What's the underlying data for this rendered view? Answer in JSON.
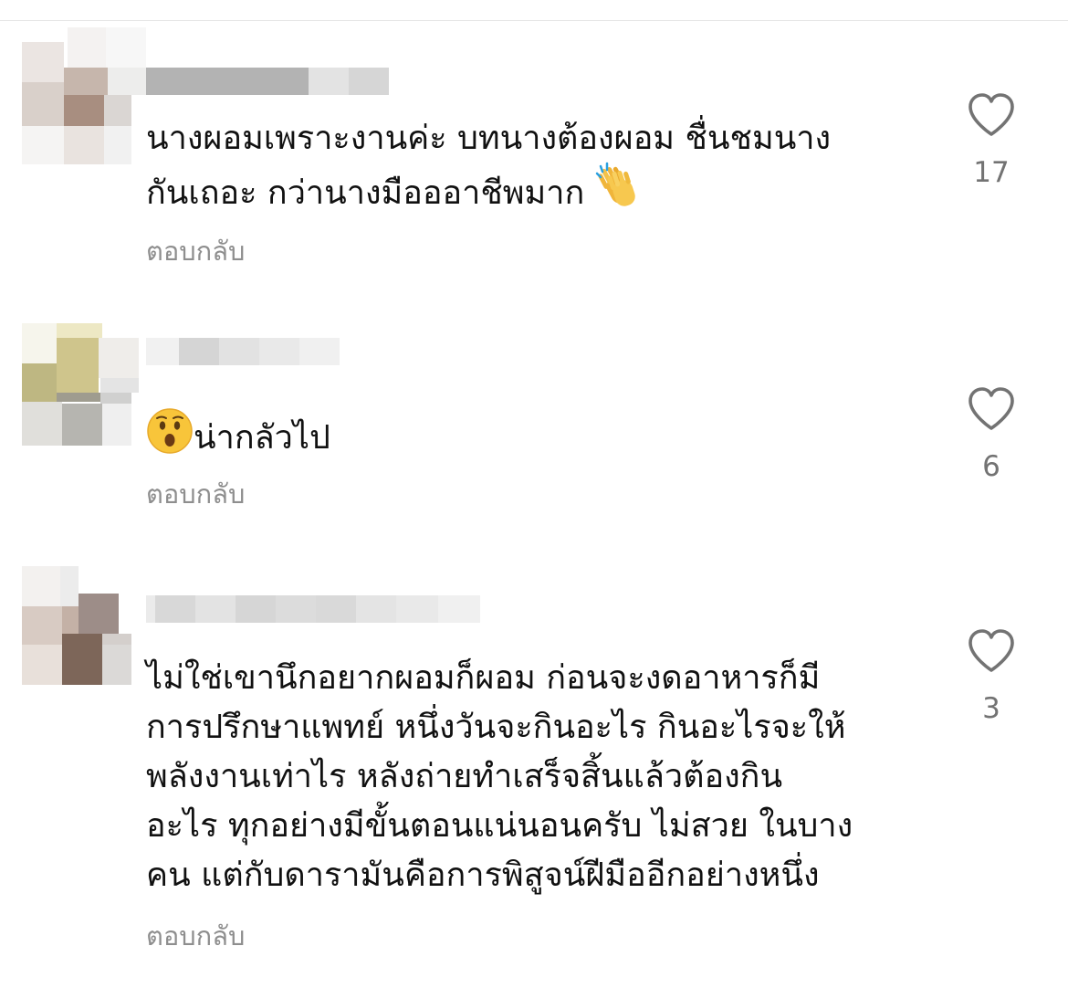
{
  "comments": [
    {
      "text_lines": [
        "นางผอมเพราะงานค่ะ บทนางต้องผอม ชื่นชมนาง",
        "กันเถอะ กว่านางมือออาชีพมาก"
      ],
      "trailing_emoji": "clapping-hands-icon",
      "reply_label": "ตอบกลับ",
      "like_count": "17"
    },
    {
      "leading_emoji": "surprised-face-icon",
      "text_lines": [
        "น่ากลัวไป"
      ],
      "reply_label": "ตอบกลับ",
      "like_count": "6"
    },
    {
      "text_lines": [
        "ไม่ใช่เขานึกอยากผอมก็ผอม ก่อนจะงดอาหารก็มี",
        "การปรึกษาแพทย์ หนึ่งวันจะกินอะไร กินอะไรจะให้",
        "พลังงานเท่าไร หลังถ่ายทำเสร็จสิ้นแล้วต้องกิน",
        "อะไร ทุกอย่างมีขั้นตอนแน่นอนครับ ไม่สวย ในบาง",
        "คน แต่กับดารามันคือการพิสูจน์ฝีมืออีกอย่างหนึ่ง"
      ],
      "reply_label": "ตอบกลับ",
      "like_count": "3"
    }
  ],
  "colors": {
    "text": "#111111",
    "secondary": "#8e8e8e",
    "like_count": "#737373",
    "divider": "#e6e6e6"
  }
}
